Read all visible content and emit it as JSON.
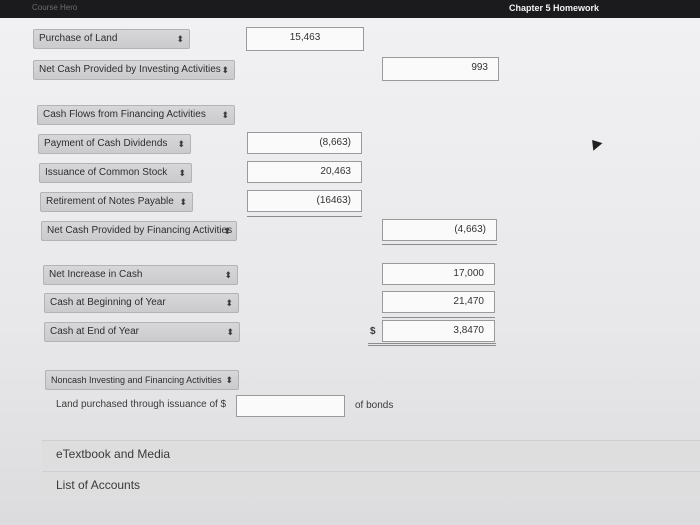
{
  "header": {
    "left_text": "Course Hero",
    "right_title": "Chapter 5 Homework"
  },
  "arrow_glyph": "⬍",
  "rows": [
    {
      "label": "Purchase of Land",
      "col1": "15,463",
      "col2": ""
    },
    {
      "label": "Net Cash Provided by Investing Activities",
      "col1": "",
      "col2": "993"
    },
    {
      "label": "Cash Flows from Financing Activities",
      "col1": "",
      "col2": ""
    },
    {
      "label": "Payment of Cash Dividends",
      "col1": "(8,663)",
      "col2": ""
    },
    {
      "label": "Issuance of Common Stock",
      "col1": "20,463",
      "col2": ""
    },
    {
      "label": "Retirement of Notes Payable",
      "col1": "(16463)",
      "col2": ""
    },
    {
      "label": "Net Cash Provided by Financing Activities",
      "col1": "",
      "col2": "(4,663)"
    },
    {
      "label": "Net Increase in Cash",
      "col1": "",
      "col2": "17,000"
    },
    {
      "label": "Cash at Beginning of Year",
      "col1": "",
      "col2": "21,470"
    },
    {
      "label": "Cash at End of Year",
      "col1": "",
      "col2": "3,8470"
    }
  ],
  "dollar_sign": "$",
  "noncash": {
    "label": "Noncash Investing and Financing Activities",
    "sentence_prefix": "Land purchased through issuance of $",
    "amount": "",
    "sentence_suffix": "of bonds"
  },
  "panels": {
    "etextbook": "eTextbook and Media",
    "accounts": "List of Accounts"
  }
}
